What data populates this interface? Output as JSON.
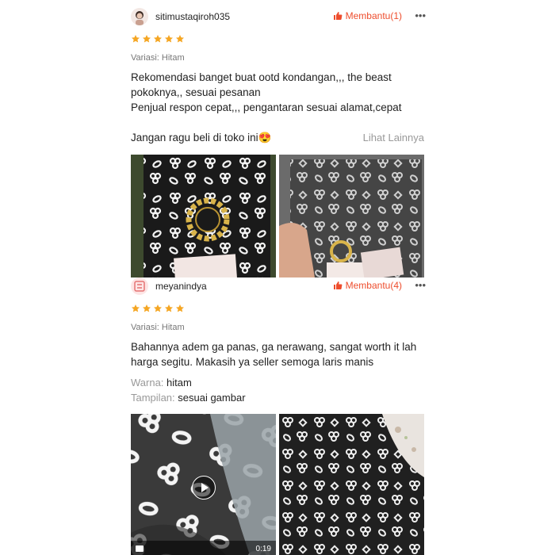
{
  "reviews": [
    {
      "username": "sitimustaqiroh035",
      "helpful_label": "Membantu(1)",
      "more_label": "•••",
      "rating": 5,
      "variant": "Variasi: Hitam",
      "text_lines": [
        "Rekomendasi banget buat ootd kondangan,,, the beast",
        "pokoknya,, sesuai pesanan",
        "Penjual respon cepat,,, pengantaran sesuai alamat,cepat",
        "",
        "Jangan ragu beli di toko ini😍"
      ],
      "see_more": "Lihat Lainnya"
    },
    {
      "username": "meyanindya",
      "helpful_label": "Membantu(4)",
      "more_label": "•••",
      "rating": 5,
      "variant": "Variasi: Hitam",
      "text_lines": [
        "Bahannya adem ga panas, ga nerawang, sangat worth it lah",
        "harga segitu. Makasih ya seller semoga laris manis"
      ],
      "color_key": "Warna:",
      "color_value": "hitam",
      "look_key": "Tampilan:",
      "look_value": "sesuai gambar",
      "video_duration": "0:19"
    }
  ],
  "colors": {
    "accent": "#ee4d2d",
    "star": "#f5a623",
    "muted": "#999999"
  }
}
